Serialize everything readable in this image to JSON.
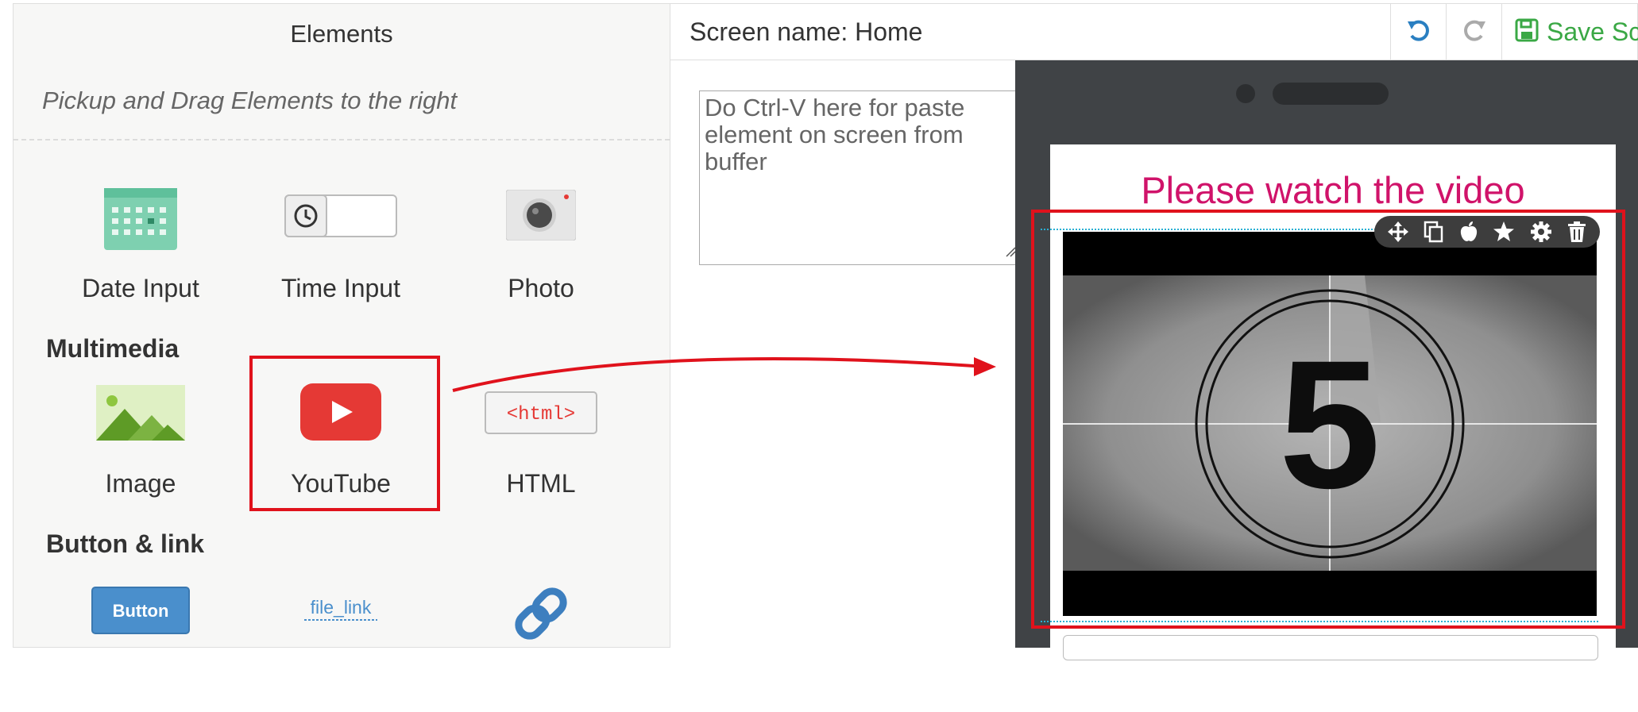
{
  "left_panel": {
    "title": "Elements",
    "subtitle": "Pickup and Drag Elements to the right",
    "top_items": [
      {
        "label": "Date Input",
        "icon": "calendar-icon"
      },
      {
        "label": "Time Input",
        "icon": "clock-icon"
      },
      {
        "label": "Photo",
        "icon": "camera-icon"
      }
    ],
    "multimedia": {
      "title": "Multimedia",
      "items": [
        {
          "label": "Image",
          "icon": "image-icon"
        },
        {
          "label": "YouTube",
          "icon": "youtube-play-icon"
        },
        {
          "label": "HTML",
          "icon": "html-tag-icon",
          "icon_text": "<html>"
        }
      ]
    },
    "button_link": {
      "title": "Button & link",
      "items": [
        {
          "label": "Button",
          "icon": "button-icon"
        },
        {
          "label": "file_link",
          "icon": "file-link-icon"
        },
        {
          "label": "",
          "icon": "chain-link-icon"
        }
      ]
    }
  },
  "topbar": {
    "screen_name": "Screen name: Home",
    "undo_icon": "undo-icon",
    "redo_icon": "redo-icon",
    "save_label": "Save Sc"
  },
  "paste_area": {
    "text": "Do Ctrl-V here for paste element on screen from buffer"
  },
  "phone": {
    "heading": "Please watch the video",
    "video_countdown": "5",
    "toolbar_icons": [
      "move-icon",
      "copy-icon",
      "apple-icon",
      "star-icon",
      "gear-icon",
      "trash-icon"
    ]
  },
  "colors": {
    "highlight": "#e0121c",
    "heading": "#d0136a",
    "save": "#3aa845",
    "undo": "#2a7fc1",
    "youtube": "#e53935",
    "button": "#4a8fcc"
  }
}
